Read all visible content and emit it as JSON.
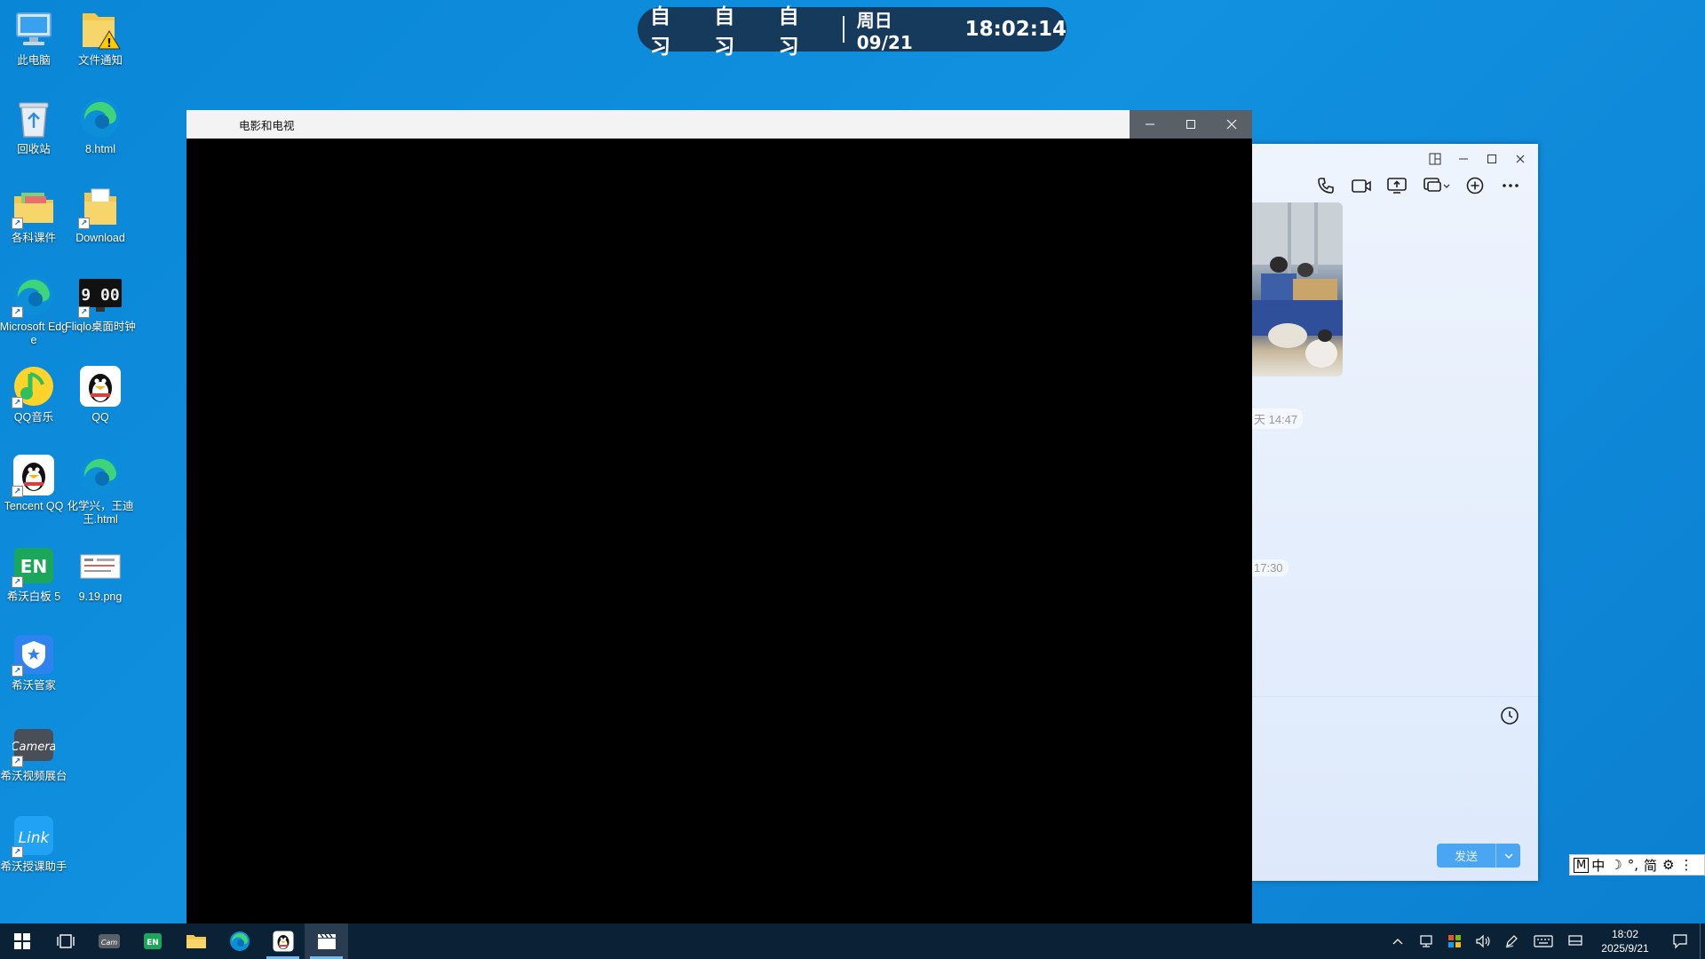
{
  "island": {
    "subjects": [
      "自习",
      "自习",
      "自习"
    ],
    "date": "周日 09/21",
    "time": "18:02:14"
  },
  "desktop_icons": [
    {
      "label": "此电脑",
      "icon": "computer-icon"
    },
    {
      "label": "文件通知",
      "icon": "folder-warning-icon"
    },
    {
      "label": "回收站",
      "icon": "recycle-bin-icon"
    },
    {
      "label": "8.html",
      "icon": "edge-icon"
    },
    {
      "label": "各科课件",
      "icon": "folder-icon"
    },
    {
      "label": "Download",
      "icon": "folder-doc-icon"
    },
    {
      "label": "Microsoft Edge",
      "icon": "edge-icon"
    },
    {
      "label": "Fliqlo桌面时钟",
      "icon": "flip-clock-icon"
    },
    {
      "label": "QQ音乐",
      "icon": "qq-music-icon"
    },
    {
      "label": "QQ",
      "icon": "qq-penguin-icon"
    },
    {
      "label": "Tencent QQ",
      "icon": "qq-penguin-icon"
    },
    {
      "label": "化学兴，王迪王.html",
      "icon": "edge-icon"
    },
    {
      "label": "希沃白板 5",
      "icon": "seewo-en-icon"
    },
    {
      "label": "9.19.png",
      "icon": "image-file-icon"
    },
    {
      "label": "希沃管家",
      "icon": "shield-icon"
    },
    {
      "label": "希沃视频展台",
      "icon": "camera-icon"
    },
    {
      "label": "希沃授课助手",
      "icon": "link-icon"
    }
  ],
  "fliqlo_text": "9 00",
  "movie_window": {
    "title": "电影和电视"
  },
  "qq_window": {
    "timestamps": [
      "天 14:47",
      "17:30"
    ],
    "send_label": "发送"
  },
  "ime": {
    "items": [
      "M",
      "中",
      "☽",
      "°,",
      "简",
      "⚙",
      "⋮"
    ]
  },
  "taskbar": {
    "clock_time": "18:02",
    "clock_date": "2025/9/21"
  },
  "colors": {
    "desktop": "#0a86d6",
    "island": "#163a5c",
    "taskbar": "#0b2136",
    "qq_send": "#4aa6f2"
  }
}
